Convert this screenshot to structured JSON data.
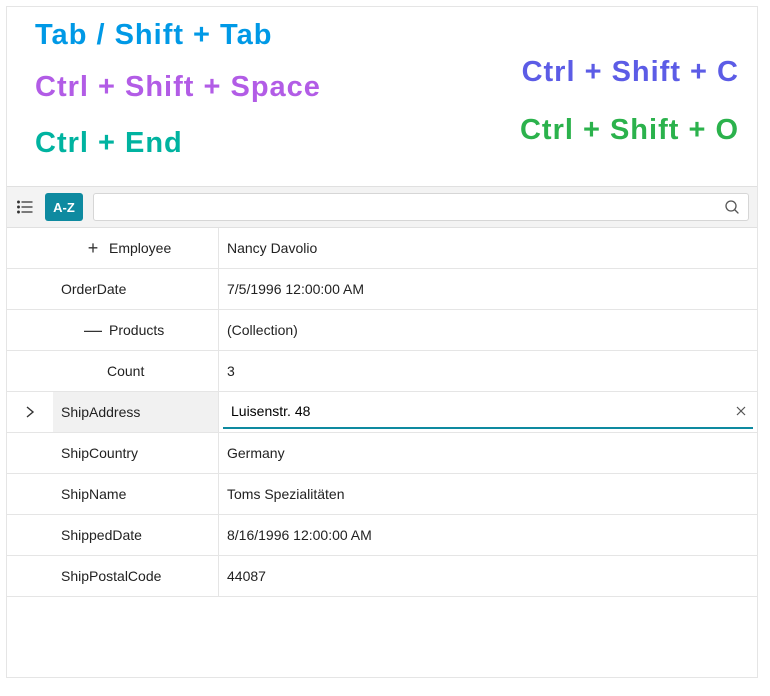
{
  "shortcuts": {
    "tab": "Tab / Shift + Tab",
    "ctrl_space": "Ctrl + Shift + Space",
    "ctrl_c": "Ctrl + Shift + C",
    "ctrl_end": "Ctrl + End",
    "ctrl_o": "Ctrl + Shift + O"
  },
  "toolbar": {
    "sort_label": "A-Z",
    "search_value": ""
  },
  "grid": {
    "rows": [
      {
        "key": "Employee",
        "value": "Nancy Davolio",
        "indent": 2,
        "toggle": "plus"
      },
      {
        "key": "OrderDate",
        "value": "7/5/1996 12:00:00 AM",
        "indent": 1
      },
      {
        "key": "Products",
        "value": "(Collection)",
        "indent": 2,
        "toggle": "minus"
      },
      {
        "key": "Count",
        "value": "3",
        "indent": 3
      },
      {
        "key": "ShipAddress",
        "value": "Luisenstr. 48",
        "indent": 1,
        "selected": true,
        "editing": true
      },
      {
        "key": "ShipCountry",
        "value": "Germany",
        "indent": 1
      },
      {
        "key": "ShipName",
        "value": "Toms Spezialitäten",
        "indent": 1
      },
      {
        "key": "ShippedDate",
        "value": "8/16/1996 12:00:00 AM",
        "indent": 1
      },
      {
        "key": "ShipPostalCode",
        "value": "44087",
        "indent": 1
      }
    ]
  }
}
